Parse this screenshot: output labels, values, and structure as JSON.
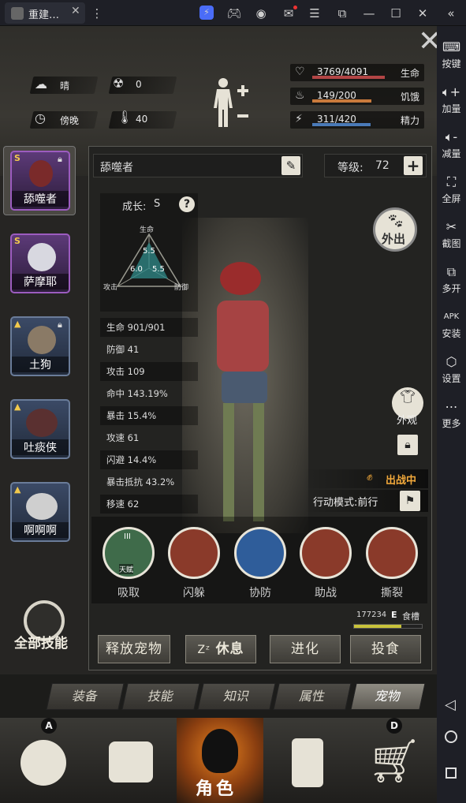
{
  "window": {
    "tab_title": "重建…",
    "close": "✕",
    "menu": "⋮"
  },
  "titlebar_icons": [
    "app-icon",
    "gamepad-icon",
    "account-icon",
    "mail-icon",
    "menu-icon",
    "popout-icon",
    "minimize-icon",
    "maximize-icon",
    "close-icon",
    "collapse-icon"
  ],
  "sidebar": {
    "items": [
      {
        "label": "按键",
        "icon": "keyboard-icon"
      },
      {
        "label": "加量",
        "icon": "volume-up-icon"
      },
      {
        "label": "减量",
        "icon": "volume-down-icon"
      },
      {
        "label": "全屏",
        "icon": "fullscreen-icon"
      },
      {
        "label": "截图",
        "icon": "scissors-icon"
      },
      {
        "label": "多开",
        "icon": "multi-instance-icon"
      },
      {
        "label": "安装",
        "icon": "apk-icon"
      },
      {
        "label": "设置",
        "icon": "settings-icon"
      },
      {
        "label": "更多",
        "icon": "more-icon"
      }
    ],
    "nav": [
      "back-icon",
      "home-icon",
      "recents-icon"
    ]
  },
  "status": {
    "weather": "晴",
    "radiation": "0",
    "time_of_day": "傍晚",
    "temperature": "40",
    "hp": {
      "value": "3769/4091",
      "label": "生命",
      "fraction": 0.92,
      "color": "#b34545"
    },
    "hunger": {
      "value": "149/200",
      "label": "饥饿",
      "fraction": 0.75,
      "color": "#c97a3c"
    },
    "energy": {
      "value": "311/420",
      "label": "精力",
      "fraction": 0.74,
      "color": "#4a7ab8"
    }
  },
  "pets": [
    {
      "name": "舔噬者",
      "badge": "S",
      "locked": true,
      "selected": true
    },
    {
      "name": "萨摩耶",
      "badge": "S",
      "locked": false
    },
    {
      "name": "土狗",
      "badge": "",
      "locked": true
    },
    {
      "name": "吐痰侠",
      "badge": "",
      "locked": false
    },
    {
      "name": "啊啊啊",
      "badge": "",
      "locked": false
    }
  ],
  "pet": {
    "name": "舔噬者",
    "level_label": "等级:",
    "level": "72",
    "growth_label": "成长:",
    "growth": "S",
    "help": "?",
    "radar": {
      "top_label": "生命",
      "left_label": "攻击",
      "right_label": "防御",
      "top_value": "5.5",
      "left_value": "6.0",
      "right_value": "5.5"
    },
    "stats": [
      {
        "label": "生命 901/901"
      },
      {
        "label": "防御 41"
      },
      {
        "label": "攻击 109"
      },
      {
        "label": "命中 143.19%"
      },
      {
        "label": "暴击 15.4%"
      },
      {
        "label": "攻速 61"
      },
      {
        "label": "闪避 14.4%"
      },
      {
        "label": "暴击抵抗 43.2%"
      },
      {
        "label": "移速 62"
      }
    ],
    "go_out": "外出",
    "appearance": "外观",
    "deployed": "出战中",
    "mode": "行动模式:前行",
    "food_count": "177234",
    "food_grade": "E",
    "food_label": "食槽",
    "food_fraction": 0.7
  },
  "skills": [
    {
      "label": "吸取",
      "badge": "III",
      "sub": "天赋",
      "color": "#3f6b4a"
    },
    {
      "label": "闪躲",
      "color": "#8a3a2a"
    },
    {
      "label": "协防",
      "color": "#2f5d9a"
    },
    {
      "label": "助战",
      "color": "#8a3a2a"
    },
    {
      "label": "撕裂",
      "color": "#8a3a2a"
    }
  ],
  "all_skills": "全部技能",
  "actions": {
    "release": "释放宠物",
    "rest": "休息",
    "evolve": "进化",
    "feed": "投食"
  },
  "subtabs": [
    "装备",
    "技能",
    "知识",
    "属性",
    "宠物"
  ],
  "bottom_nav": {
    "letters": [
      "A",
      "D"
    ],
    "active_label": "角色"
  }
}
